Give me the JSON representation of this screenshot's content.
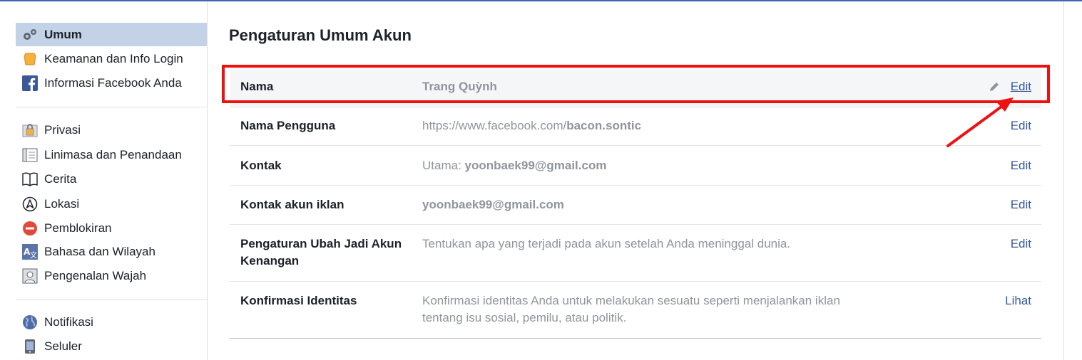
{
  "sidebar": {
    "items": [
      {
        "label": "Umum",
        "icon": "gears-icon",
        "active": true
      },
      {
        "label": "Keamanan dan Info Login",
        "icon": "shield-badge-icon"
      },
      {
        "label": "Informasi Facebook Anda",
        "icon": "facebook-icon"
      },
      {
        "label": "Privasi",
        "icon": "lock-icon"
      },
      {
        "label": "Linimasa dan Penandaan",
        "icon": "timeline-icon"
      },
      {
        "label": "Cerita",
        "icon": "book-icon"
      },
      {
        "label": "Lokasi",
        "icon": "location-icon"
      },
      {
        "label": "Pemblokiran",
        "icon": "block-icon"
      },
      {
        "label": "Bahasa dan Wilayah",
        "icon": "language-icon"
      },
      {
        "label": "Pengenalan Wajah",
        "icon": "face-icon"
      },
      {
        "label": "Notifikasi",
        "icon": "globe-icon"
      },
      {
        "label": "Seluler",
        "icon": "mobile-icon"
      }
    ]
  },
  "main": {
    "title": "Pengaturan Umum Akun",
    "rows": [
      {
        "label": "Nama",
        "value": "Trang Quỳnh",
        "action": "Edit"
      },
      {
        "label": "Nama Pengguna",
        "value_prefix": "https://www.facebook.com/",
        "value_bold": "bacon.sontic",
        "action": "Edit"
      },
      {
        "label": "Kontak",
        "value_prefix": "Utama: ",
        "value_bold": "yoonbaek99@gmail.com",
        "action": "Edit"
      },
      {
        "label": "Kontak akun iklan",
        "value_bold": "yoonbaek99@gmail.com",
        "action": "Edit"
      },
      {
        "label": "Pengaturan Ubah Jadi Akun Kenangan",
        "value": "Tentukan apa yang terjadi pada akun setelah Anda meninggal dunia.",
        "action": "Edit"
      },
      {
        "label": "Konfirmasi Identitas",
        "value": "Konfirmasi identitas Anda untuk melakukan sesuatu seperti menjalankan iklan tentang isu sosial, pemilu, atau politik.",
        "action": "Lihat"
      }
    ]
  },
  "colors": {
    "accent": "#365899",
    "active_bg": "#c4d2e7",
    "annotation_red": "#ee1111"
  }
}
